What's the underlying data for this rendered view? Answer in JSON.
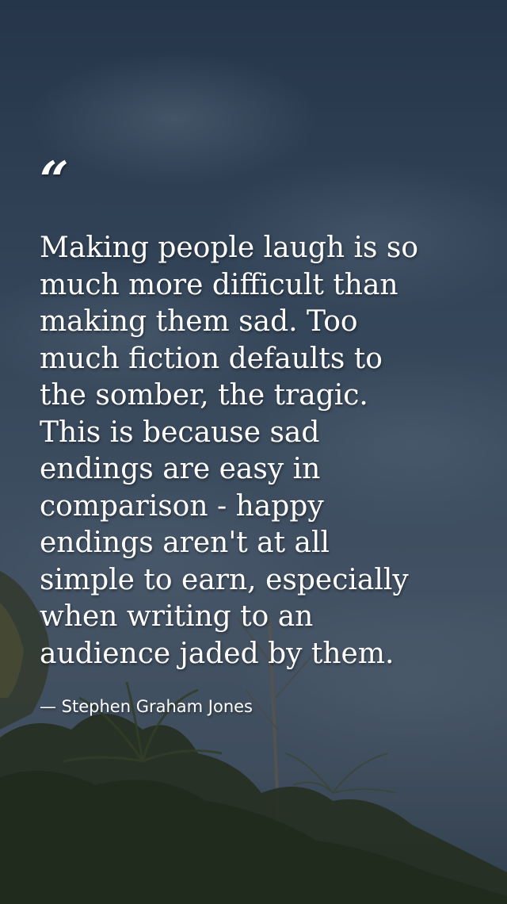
{
  "background": {
    "sky_color": "#3b5068",
    "foliage_color": "#2f3a22",
    "description_icon": "sky-and-palm-trees"
  },
  "quote": {
    "mark": "“",
    "lines": [
      "Making people laugh is so",
      "much more difficult than",
      "making them sad. Too",
      "much fiction defaults to",
      "the somber, the tragic.",
      "This is because sad",
      "endings are easy in",
      "comparison - happy",
      "endings aren't at all",
      "simple to earn, especially",
      "when writing to an",
      "audience jaded by them."
    ],
    "author": "— Stephen Graham Jones"
  }
}
